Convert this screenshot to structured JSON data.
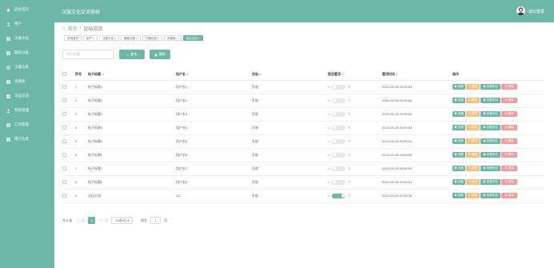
{
  "app": {
    "title": "汉服文化交流系统",
    "logout": "退出登录"
  },
  "sidebar": {
    "items": [
      {
        "label": "后台首页",
        "icon": "home-icon",
        "has_sub": false
      },
      {
        "label": "用户",
        "icon": "user-icon",
        "has_sub": false
      },
      {
        "label": "汉服文化",
        "icon": "grid-icon",
        "has_sub": false
      },
      {
        "label": "服装分类",
        "icon": "grid-icon",
        "has_sub": false
      },
      {
        "label": "汉服信息",
        "icon": "gear-icon",
        "has_sub": false
      },
      {
        "label": "资源库",
        "icon": "grid-icon",
        "has_sub": false
      },
      {
        "label": "论坛交流",
        "icon": "grid-icon",
        "has_sub": false
      },
      {
        "label": "系统管理",
        "icon": "user-icon",
        "has_sub": true
      },
      {
        "label": "订单管理",
        "icon": "grid-icon",
        "has_sub": true
      },
      {
        "label": "用户信息",
        "icon": "grid-icon",
        "has_sub": false
      }
    ]
  },
  "breadcrumb": {
    "home": "首页",
    "current": "论坛交流"
  },
  "tabs": [
    "系统首页",
    "用户",
    "汉服文化",
    "服装分类",
    "汉服信息",
    "资源库",
    "论坛交流"
  ],
  "search": {
    "placeholder": "帖子标题"
  },
  "buttons": {
    "query": "查询",
    "delete": "删除"
  },
  "table": {
    "columns": [
      "序号",
      "帖子标题",
      "用户名",
      "状态",
      "是否置顶",
      "置顶时间",
      "操作"
    ],
    "rows": [
      {
        "no": "1",
        "title": "帖子标题1",
        "user": "用户名1",
        "status": "开放",
        "pinned": false,
        "time": "2024-05-28 09:59:54"
      },
      {
        "no": "2",
        "title": "帖子标题2",
        "user": "用户名2",
        "status": "开放",
        "pinned": false,
        "time": "2024-05-28 09:59:54"
      },
      {
        "no": "3",
        "title": "帖子标题3",
        "user": "用户名3",
        "status": "开放",
        "pinned": false,
        "time": "2024-05-28 09:59:54"
      },
      {
        "no": "4",
        "title": "帖子标题4",
        "user": "用户名4",
        "status": "开放",
        "pinned": false,
        "time": "2024-05-28 09:59:54"
      },
      {
        "no": "5",
        "title": "帖子标题5",
        "user": "用户名5",
        "status": "开放",
        "pinned": false,
        "time": "2024-05-28 09:59:54"
      },
      {
        "no": "6",
        "title": "帖子标题6",
        "user": "用户名6",
        "status": "开放",
        "pinned": false,
        "time": "2024-05-28 09:59:54"
      },
      {
        "no": "7",
        "title": "帖子标题7",
        "user": "用户名7",
        "status": "开放",
        "pinned": false,
        "time": "2024-05-28 09:59:54"
      },
      {
        "no": "8",
        "title": "帖子标题8",
        "user": "用户名8",
        "status": "开放",
        "pinned": false,
        "time": "2024-05-28 09:59:54"
      },
      {
        "no": "9",
        "title": "论坛交流",
        "user": "111",
        "status": "开放",
        "pinned": true,
        "time": "2024-05-28 10:19:35"
      }
    ],
    "actions": {
      "view": "查看",
      "edit": "修改",
      "comment": "查看评论",
      "delete": "删除"
    }
  },
  "pagination": {
    "total": "共 9 条",
    "prev": "上一页",
    "page": "1",
    "next": "下一页",
    "page_size": "10条/页",
    "goto": "前往",
    "goto_value": "1",
    "page_unit": "页"
  },
  "watermark": "CSDN @茄茄学姐",
  "colors": {
    "primary": "#6cb7a5",
    "warning": "#f3c27d",
    "danger": "#f29c9c"
  }
}
